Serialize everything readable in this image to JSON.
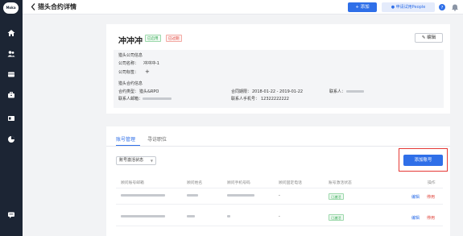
{
  "sidebar": {
    "logo": "Moka"
  },
  "header": {
    "title": "猎头合约详情",
    "add_button": "+ 添加",
    "trial_button": "申请试用People"
  },
  "contract": {
    "name": "冲冲冲",
    "badges": {
      "enabled": "已启用",
      "expired": "已过期"
    },
    "edit_button": "编辑",
    "company_section_title": "猎头公司信息",
    "company_name_label": "公司名称：",
    "company_name_value": "冲冲冲-1",
    "company_label_label": "公司标签：",
    "company_label_add": "+",
    "contract_section_title": "猎头合约信息",
    "contract_type_label": "合约类型：",
    "contract_type_value": "猎头&RPO",
    "contract_period_label": "合同期限：",
    "contract_period_value": "2018-01-22 - 2019-01-22",
    "contact_label": "联系人：",
    "contact_email_label": "联系人邮箱：",
    "contact_phone_label": "联系人手机号：",
    "contact_phone_value": "12322222222"
  },
  "accounts": {
    "tabs": [
      "账号管理",
      "寻访职位"
    ],
    "filter_placeholder": "账号激活状态",
    "add_account_button": "添加账号",
    "columns": [
      "顾问账号邮箱",
      "顾问姓名",
      "顾问手机号码",
      "顾问固定电话",
      "账号激活状态",
      "操作"
    ],
    "rows": [
      {
        "landline": "-",
        "status": "已激活",
        "edit": "编辑",
        "disable": "停用"
      },
      {
        "landline": "-",
        "status": "已激活",
        "edit": "编辑",
        "disable": "停用"
      }
    ]
  },
  "colors": {
    "primary": "#2f6fe8",
    "sidebar": "#1c2534",
    "success": "#2fa84f",
    "danger": "#e0443b",
    "highlight": "#e53935"
  },
  "icons": [
    "home-icon",
    "users-icon",
    "briefcase-icon",
    "folder-icon",
    "id-card-icon",
    "chart-icon",
    "chat-icon",
    "user-icon",
    "help-icon",
    "bell-icon",
    "chevron-left-icon"
  ]
}
